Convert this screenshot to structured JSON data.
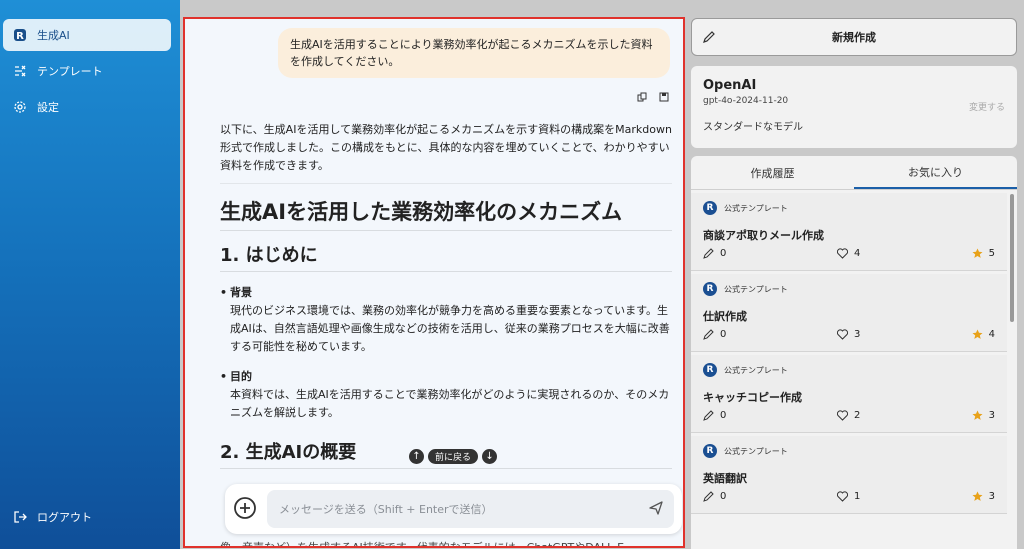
{
  "sidebar": {
    "items": [
      {
        "label": "生成AI",
        "icon": "app-logo-icon",
        "active": true
      },
      {
        "label": "テンプレート",
        "icon": "template-icon",
        "active": false
      },
      {
        "label": "設定",
        "icon": "gear-icon",
        "active": false
      }
    ],
    "logout": "ログアウト"
  },
  "chat": {
    "user_message": "生成AIを活用することにより業務効率化が起こるメカニズムを示した資料を作成してください。",
    "answer": {
      "intro": "以下に、生成AIを活用して業務効率化が起こるメカニズムを示す資料の構成案をMarkdown形式で作成しました。この構成をもとに、具体的な内容を埋めていくことで、わかりやすい資料を作成できます。",
      "h1": "生成AIを活用した業務効率化のメカニズム",
      "section1": "1. はじめに",
      "bullets": [
        {
          "term": "背景",
          "text": "現代のビジネス環境では、業務の効率化が競争力を高める重要な要素となっています。生成AIは、自然言語処理や画像生成などの技術を活用し、従来の業務プロセスを大幅に改善する可能性を秘めています。"
        },
        {
          "term": "目的",
          "text": "本資料では、生成AIを活用することで業務効率化がどのように実現されるのか、そのメカニズムを解説します。"
        }
      ],
      "section2": "2. 生成AIの概要",
      "tail": "像、音声など）を生成するAI技術です。代表的なモデルには、ChatGPTやDALL-E、"
    },
    "back_label": "前に戻る",
    "composer_placeholder": "メッセージを送る（Shift + Enterで送信）"
  },
  "right": {
    "new_button": "新規作成",
    "model": {
      "provider": "OpenAI",
      "version": "gpt-4o-2024-11-20",
      "description": "スタンダードなモデル",
      "change": "変更する"
    },
    "tabs": [
      "作成履歴",
      "お気に入り"
    ],
    "templates": [
      {
        "source": "公式テンプレート",
        "title": "商談アポ取りメール作成",
        "edits": "0",
        "likes": "4",
        "stars": "5"
      },
      {
        "source": "公式テンプレート",
        "title": "仕訳作成",
        "edits": "0",
        "likes": "3",
        "stars": "4"
      },
      {
        "source": "公式テンプレート",
        "title": "キャッチコピー作成",
        "edits": "0",
        "likes": "2",
        "stars": "3"
      },
      {
        "source": "公式テンプレート",
        "title": "英語翻訳",
        "edits": "0",
        "likes": "1",
        "stars": "3"
      }
    ]
  },
  "colors": {
    "accent": "#1b5fa8",
    "highlight_border": "#e0322c",
    "user_bubble": "#fbeedc",
    "star": "#e8a21a"
  }
}
